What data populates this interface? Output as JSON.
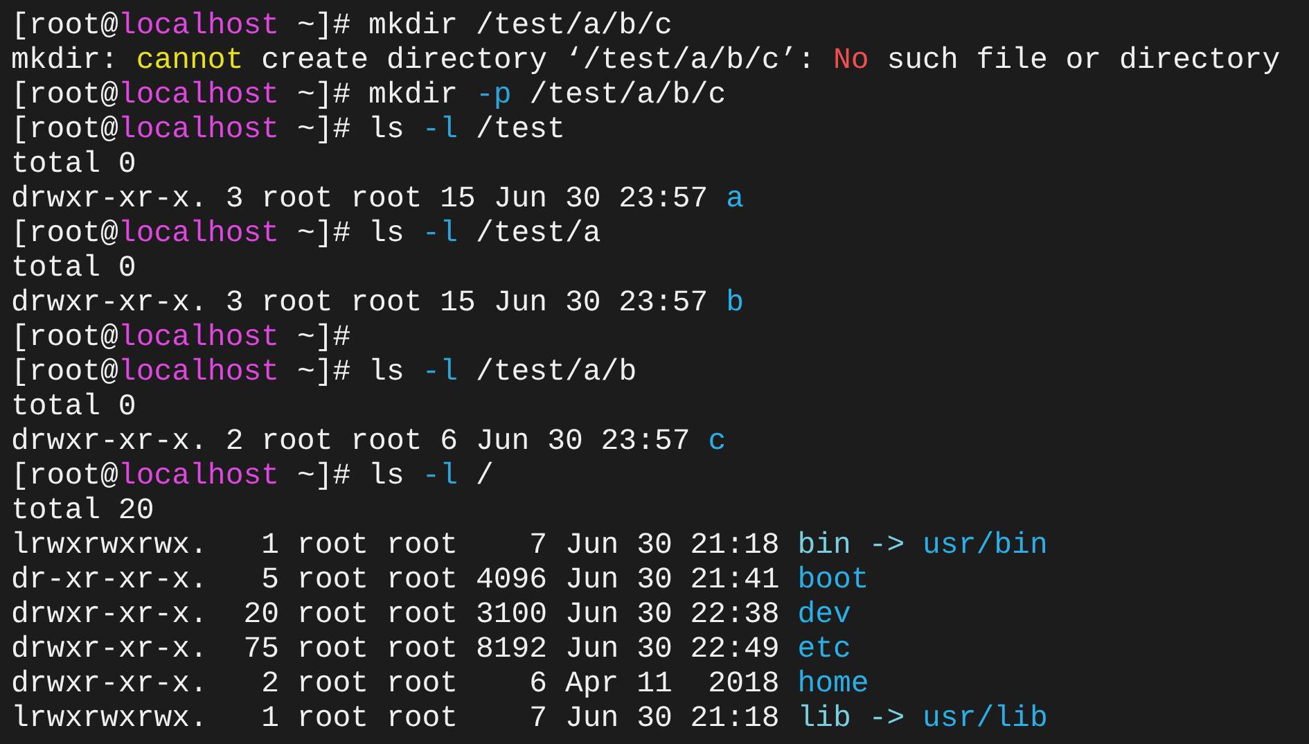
{
  "terminal": {
    "lines": [
      {
        "segments": [
          {
            "text": "[root@",
            "kind": "plain"
          },
          {
            "text": "localhost",
            "kind": "host"
          },
          {
            "text": " ~]# mkdir /test/a/b/c",
            "kind": "plain"
          }
        ]
      },
      {
        "segments": [
          {
            "text": "mkdir: ",
            "kind": "plain"
          },
          {
            "text": "cannot",
            "kind": "warn"
          },
          {
            "text": " create directory ‘/test/a/b/c’: ",
            "kind": "plain"
          },
          {
            "text": "No",
            "kind": "error"
          },
          {
            "text": " such file or directory",
            "kind": "plain"
          }
        ]
      },
      {
        "segments": [
          {
            "text": "[root@",
            "kind": "plain"
          },
          {
            "text": "localhost",
            "kind": "host"
          },
          {
            "text": " ~]# mkdir ",
            "kind": "plain"
          },
          {
            "text": "-p",
            "kind": "option"
          },
          {
            "text": " /test/a/b/c",
            "kind": "plain"
          }
        ]
      },
      {
        "segments": [
          {
            "text": "[root@",
            "kind": "plain"
          },
          {
            "text": "localhost",
            "kind": "host"
          },
          {
            "text": " ~]# ls ",
            "kind": "plain"
          },
          {
            "text": "-l",
            "kind": "option"
          },
          {
            "text": " /test",
            "kind": "plain"
          }
        ]
      },
      {
        "segments": [
          {
            "text": "total 0",
            "kind": "plain"
          }
        ]
      },
      {
        "segments": [
          {
            "text": "drwxr-xr-x. 3 root root 15 Jun 30 23:57 ",
            "kind": "plain"
          },
          {
            "text": "a",
            "kind": "dir"
          }
        ]
      },
      {
        "segments": [
          {
            "text": "[root@",
            "kind": "plain"
          },
          {
            "text": "localhost",
            "kind": "host"
          },
          {
            "text": " ~]# ls ",
            "kind": "plain"
          },
          {
            "text": "-l",
            "kind": "option"
          },
          {
            "text": " /test/a",
            "kind": "plain"
          }
        ]
      },
      {
        "segments": [
          {
            "text": "total 0",
            "kind": "plain"
          }
        ]
      },
      {
        "segments": [
          {
            "text": "drwxr-xr-x. 3 root root 15 Jun 30 23:57 ",
            "kind": "plain"
          },
          {
            "text": "b",
            "kind": "dir"
          }
        ]
      },
      {
        "segments": [
          {
            "text": "[root@",
            "kind": "plain"
          },
          {
            "text": "localhost",
            "kind": "host"
          },
          {
            "text": " ~]#",
            "kind": "plain"
          }
        ]
      },
      {
        "segments": [
          {
            "text": "[root@",
            "kind": "plain"
          },
          {
            "text": "localhost",
            "kind": "host"
          },
          {
            "text": " ~]# ls ",
            "kind": "plain"
          },
          {
            "text": "-l",
            "kind": "option"
          },
          {
            "text": " /test/a/b",
            "kind": "plain"
          }
        ]
      },
      {
        "segments": [
          {
            "text": "total 0",
            "kind": "plain"
          }
        ]
      },
      {
        "segments": [
          {
            "text": "drwxr-xr-x. 2 root root 6 Jun 30 23:57 ",
            "kind": "plain"
          },
          {
            "text": "c",
            "kind": "dir"
          }
        ]
      },
      {
        "segments": [
          {
            "text": "[root@",
            "kind": "plain"
          },
          {
            "text": "localhost",
            "kind": "host"
          },
          {
            "text": " ~]# ls ",
            "kind": "plain"
          },
          {
            "text": "-l",
            "kind": "option"
          },
          {
            "text": " /",
            "kind": "plain"
          }
        ]
      },
      {
        "segments": [
          {
            "text": "total 20",
            "kind": "plain"
          }
        ]
      },
      {
        "segments": [
          {
            "text": "lrwxrwxrwx.   1 root root    7 Jun 30 21:18 ",
            "kind": "plain"
          },
          {
            "text": "bin -> ",
            "kind": "link"
          },
          {
            "text": "usr/bin",
            "kind": "dir"
          }
        ]
      },
      {
        "segments": [
          {
            "text": "dr-xr-xr-x.   5 root root 4096 Jun 30 21:41 ",
            "kind": "plain"
          },
          {
            "text": "boot",
            "kind": "dir"
          }
        ]
      },
      {
        "segments": [
          {
            "text": "drwxr-xr-x.  20 root root 3100 Jun 30 22:38 ",
            "kind": "plain"
          },
          {
            "text": "dev",
            "kind": "dir"
          }
        ]
      },
      {
        "segments": [
          {
            "text": "drwxr-xr-x.  75 root root 8192 Jun 30 22:49 ",
            "kind": "plain"
          },
          {
            "text": "etc",
            "kind": "dir"
          }
        ]
      },
      {
        "segments": [
          {
            "text": "drwxr-xr-x.   2 root root    6 Apr 11  2018 ",
            "kind": "plain"
          },
          {
            "text": "home",
            "kind": "dir"
          }
        ]
      },
      {
        "segments": [
          {
            "text": "lrwxrwxrwx.   1 root root    7 Jun 30 21:18 ",
            "kind": "plain"
          },
          {
            "text": "lib -> ",
            "kind": "link"
          },
          {
            "text": "usr/lib",
            "kind": "dir"
          }
        ]
      }
    ]
  }
}
